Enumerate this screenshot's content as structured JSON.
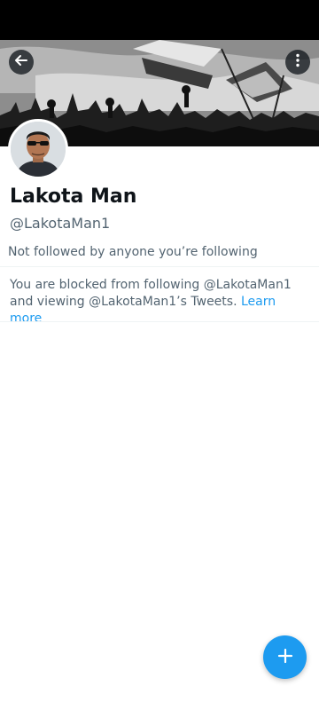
{
  "profile": {
    "display_name": "Lakota Man",
    "handle": "@LakotaMan1",
    "followed_note": "Not followed by anyone you’re following"
  },
  "blocked": {
    "message": "You are blocked from following @LakotaMan1 and viewing @LakotaMan1’s Tweets.",
    "link_label": "Learn more"
  },
  "icons": {
    "back": "arrow-left-icon",
    "more": "more-vertical-icon",
    "compose": "plus-icon"
  },
  "colors": {
    "accent": "#1d9bf0",
    "primary_text": "#0f1419",
    "secondary_text": "#536471",
    "status_bar": "#000000"
  }
}
